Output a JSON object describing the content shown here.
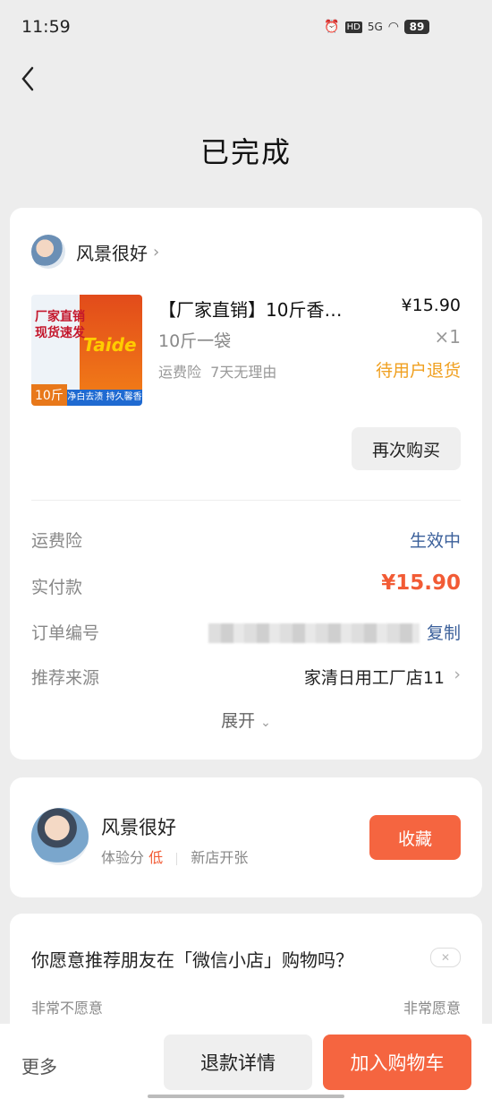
{
  "status_bar": {
    "time": "11:59",
    "battery": "89",
    "network": "5G"
  },
  "header": {
    "title": "已完成"
  },
  "order": {
    "shop_name": "风景很好",
    "product": {
      "title": "【厂家直销】10斤香…",
      "price": "¥15.90",
      "spec": "10斤一袋",
      "qty": "×1",
      "tags": "运费险  7天无理由",
      "status": "待用户退货",
      "image_texts": {
        "promo": "厂家直销\n现货速发",
        "brand": "Taide",
        "weight": "10斤",
        "slogan": "净白去渍 持久馨香"
      }
    },
    "rebuy_label": "再次购买",
    "rows": {
      "insurance_label": "运费险",
      "insurance_value": "生效中",
      "paid_label": "实付款",
      "paid_value": "¥15.90",
      "order_no_label": "订单编号",
      "copy_label": "复制",
      "source_label": "推荐来源",
      "source_value": "家清日用工厂店11"
    },
    "expand_label": "展开"
  },
  "seller": {
    "name": "风景很好",
    "score_label": "体验分",
    "score_value": "低",
    "shop_tag": "新店开张",
    "fav_label": "收藏"
  },
  "survey": {
    "question": "你愿意推荐朋友在「微信小店」购物吗？",
    "left": "非常不愿意",
    "right": "非常愿意"
  },
  "bottom": {
    "more": "更多",
    "refund": "退款详情",
    "cart": "加入购物车"
  },
  "colors": {
    "accent": "#f56540",
    "link": "#3a5f9a",
    "warn": "#f0a020"
  }
}
